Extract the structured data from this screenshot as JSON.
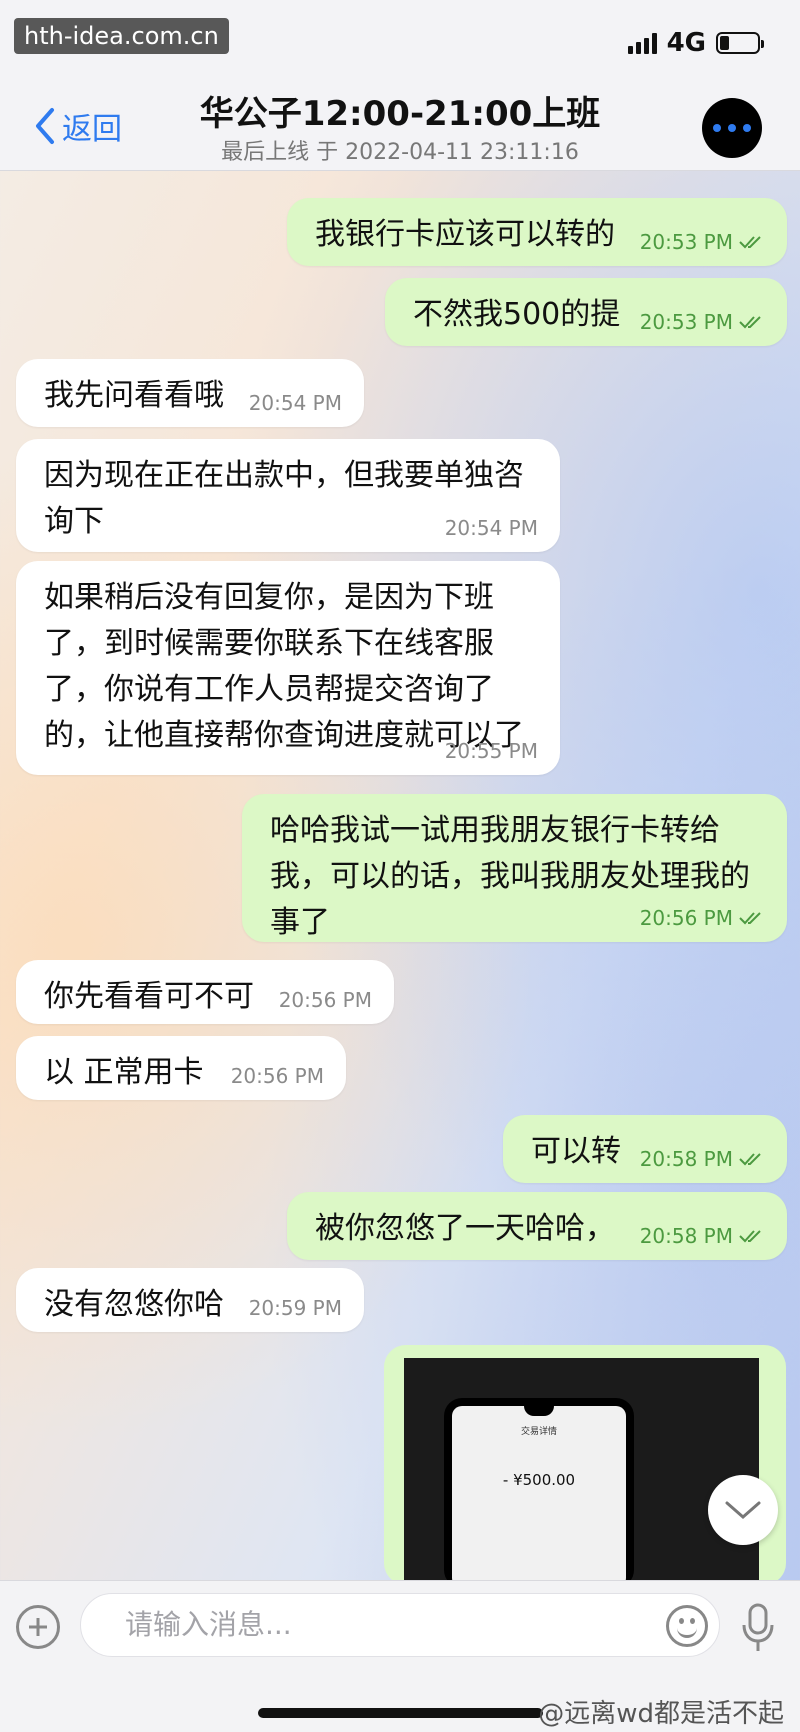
{
  "watermark_top": "hth-idea.com.cn",
  "status": {
    "network": "4G",
    "battery_level": 0.25
  },
  "header": {
    "back_label": "返回",
    "title": "华公子12:00-21:00上班",
    "subtitle": "最后上线 于 2022-04-11 23:11:16"
  },
  "messages": [
    {
      "dir": "out",
      "text": "我银行卡应该可以转的",
      "time": "20:53 PM"
    },
    {
      "dir": "out",
      "text": "不然我500的提",
      "time": "20:53 PM"
    },
    {
      "dir": "in",
      "text": "我先问看看哦",
      "time": "20:54 PM"
    },
    {
      "dir": "in",
      "text": "因为现在正在出款中，但我要单独咨询下",
      "time": "20:54 PM"
    },
    {
      "dir": "in",
      "text": "如果稍后没有回复你，是因为下班了，到时候需要你联系下在线客服了，你说有工作人员帮提交咨询了的，让他直接帮你查询进度就可以了",
      "time": "20:55 PM"
    },
    {
      "dir": "out",
      "text": "哈哈我试一试用我朋友银行卡转给我，可以的话，我叫我朋友处理我的事了",
      "time": "20:56 PM"
    },
    {
      "dir": "in",
      "text": "你先看看可不可",
      "time": "20:56 PM"
    },
    {
      "dir": "in",
      "text": "以 正常用卡",
      "time": "20:56 PM"
    },
    {
      "dir": "out",
      "text": "可以转",
      "time": "20:58 PM"
    },
    {
      "dir": "out",
      "text": "被你忽悠了一天哈哈，",
      "time": "20:58 PM"
    },
    {
      "dir": "in",
      "text": "没有忽悠你哈",
      "time": "20:59 PM"
    }
  ],
  "photo": {
    "screen_title": "交易详情",
    "amount": "- ¥500.00"
  },
  "input": {
    "placeholder": "请输入消息..."
  },
  "bottom_watermark": "@远离wd都是活不起"
}
